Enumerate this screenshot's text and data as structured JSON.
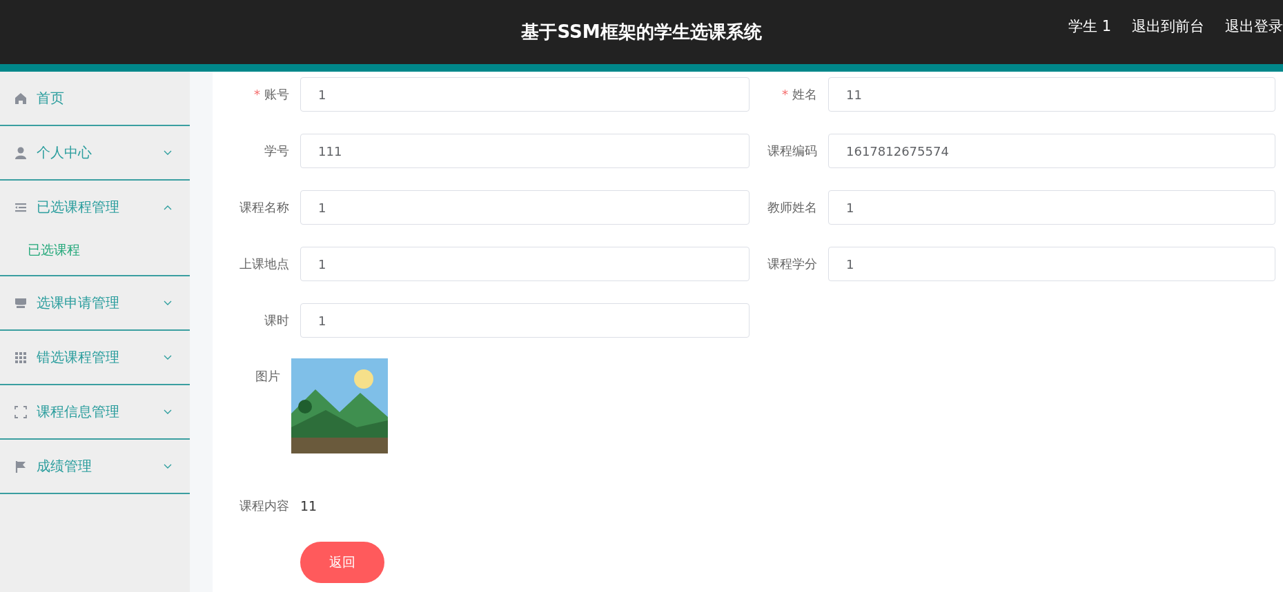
{
  "header": {
    "title": "基于SSM框架的学生选课系统",
    "nav": [
      "学生 1",
      "退出到前台",
      "退出登录"
    ]
  },
  "sidebar": {
    "items": [
      {
        "label": "首页"
      },
      {
        "label": "个人中心",
        "expanded": false
      },
      {
        "label": "已选课程管理",
        "expanded": true,
        "children": [
          {
            "label": "已选课程"
          }
        ]
      },
      {
        "label": "选课申请管理",
        "expanded": false
      },
      {
        "label": "错选课程管理",
        "expanded": false
      },
      {
        "label": "课程信息管理",
        "expanded": false
      },
      {
        "label": "成绩管理",
        "expanded": false
      }
    ]
  },
  "form": {
    "fields": [
      {
        "kind": "input",
        "marker": "*",
        "label": "账号",
        "value": "1"
      },
      {
        "kind": "input",
        "marker": "*",
        "label": "姓名",
        "value": "11"
      },
      {
        "kind": "input",
        "label": "学号",
        "value": "111"
      },
      {
        "kind": "input",
        "label": "课程编码",
        "value": "1617812675574"
      },
      {
        "kind": "input",
        "label": "课程名称",
        "value": "1"
      },
      {
        "kind": "input",
        "label": "教师姓名",
        "value": "1"
      },
      {
        "kind": "input",
        "label": "上课地点",
        "value": "1"
      },
      {
        "kind": "input",
        "label": "课程学分",
        "value": "1"
      },
      {
        "kind": "input",
        "label": "课时",
        "value": "1"
      },
      {
        "label": "图片"
      },
      {
        "kind": "text",
        "label": "课程内容",
        "value": "11"
      }
    ],
    "button": "返回"
  }
}
